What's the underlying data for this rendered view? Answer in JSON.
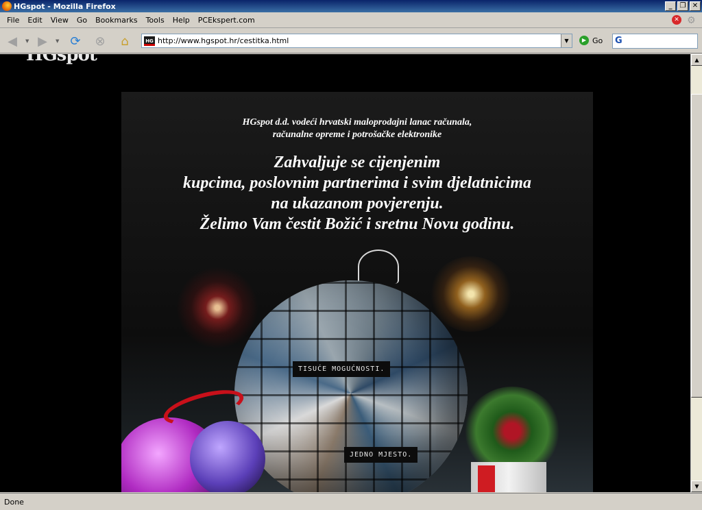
{
  "window": {
    "title": "HGspot - Mozilla Firefox"
  },
  "menu": [
    "File",
    "Edit",
    "View",
    "Go",
    "Bookmarks",
    "Tools",
    "Help",
    "PCEkspert.com"
  ],
  "toolbar": {
    "url": "http://www.hgspot.hr/cestitka.html",
    "go_label": "Go"
  },
  "page": {
    "logo": "HGspot",
    "intro_lines": [
      "HGspot d.d. vodeći hrvatski maloprodajni lanac računala,",
      "računalne opreme i potrošačke elektronike"
    ],
    "message_lines": [
      "Zahvaljuje se cijenjenim",
      "kupcima, poslovnim partnerima i svim djelatnicima",
      "na ukazanom povjerenju.",
      "Želimo Vam čestit Božić i sretnu Novu godinu."
    ],
    "label_top": "TISUĆE MOGUĆNOSTI.",
    "label_bottom": "JEDNO MJESTO."
  },
  "status": {
    "text": "Done"
  }
}
